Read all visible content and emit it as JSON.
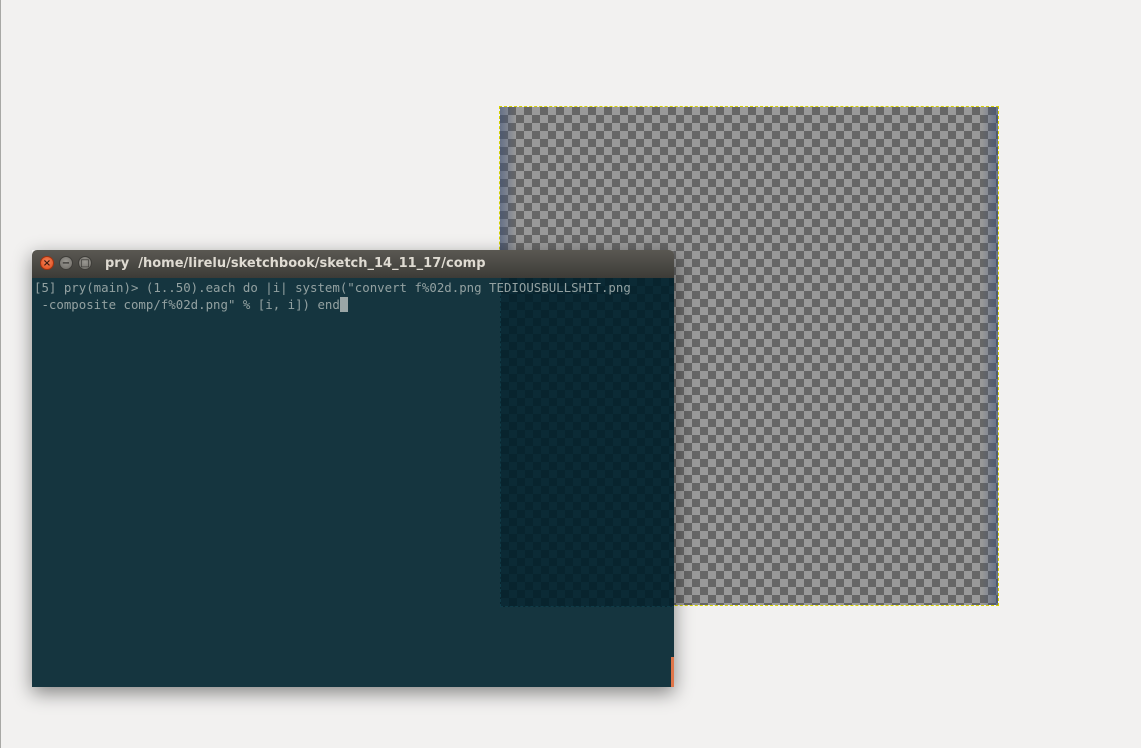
{
  "terminal": {
    "title": "pry  /home/lirelu/sketchbook/sketch_14_11_17/comp",
    "lines": [
      "[5] pry(main)> (1..50).each do |i| system(\"convert f%02d.png TEDIOUSBULLSHIT.png",
      " -composite comp/f%02d.png\" % [i, i]) end"
    ],
    "buttons": {
      "close": "×",
      "minimize": "−",
      "maximize": "□"
    }
  },
  "colors": {
    "desktop_background": "#f2f1f0",
    "terminal_background": "#15353f",
    "terminal_text": "#93a1a1",
    "titlebar": "#3c3b37",
    "close_button": "#df4a16",
    "canvas_selection_border": "#d6d000"
  },
  "icons": {
    "close": "close-icon",
    "minimize": "minimize-icon",
    "maximize": "maximize-icon"
  }
}
